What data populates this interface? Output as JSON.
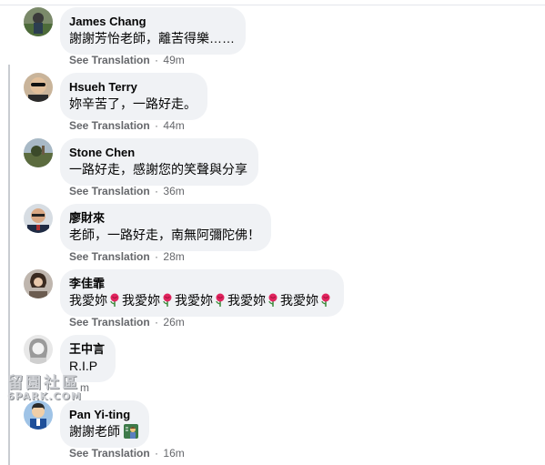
{
  "comments": [
    {
      "author": "James Chang",
      "text": "謝謝芳怡老師，離苦得樂……",
      "translate_label": "See Translation",
      "separator": "·",
      "time": "49m",
      "avatar_icon": "profile-photo-james-chang"
    },
    {
      "author": "Hsueh Terry",
      "text": "妳辛苦了，一路好走。",
      "translate_label": "See Translation",
      "separator": "·",
      "time": "44m",
      "avatar_icon": "profile-photo-hsueh-terry"
    },
    {
      "author": "Stone Chen",
      "text": "一路好走，感謝您的笑聲與分享",
      "translate_label": "See Translation",
      "separator": "·",
      "time": "36m",
      "avatar_icon": "profile-photo-stone-chen"
    },
    {
      "author": "廖財來",
      "text": "老師，一路好走，南無阿彌陀佛！",
      "translate_label": "See Translation",
      "separator": "·",
      "time": "28m",
      "avatar_icon": "profile-photo-liao"
    },
    {
      "author": "李佳霏",
      "text_segments": [
        "我愛妳",
        "我愛妳",
        "我愛妳",
        "我愛妳",
        "我愛妳"
      ],
      "inline_icon": "rose-emoji",
      "translate_label": "See Translation",
      "separator": "·",
      "time": "26m",
      "avatar_icon": "profile-photo-li"
    },
    {
      "author": "王中言",
      "text": "R.I.P",
      "time_partial": "m",
      "avatar_icon": "profile-photo-wang"
    },
    {
      "author": "Pan Yi-ting",
      "text": "謝謝老師",
      "inline_icon": "teacher-emoji",
      "translate_label": "See Translation",
      "separator": "·",
      "time": "16m",
      "avatar_icon": "profile-photo-pan"
    }
  ],
  "watermark": {
    "line1": "留園社區",
    "line2": "6PARK.COM"
  },
  "colors": {
    "bubble": "#f0f2f5",
    "meta_text": "#65676b",
    "thread_line": "#c9ccd1",
    "rose": "#e0245e"
  }
}
